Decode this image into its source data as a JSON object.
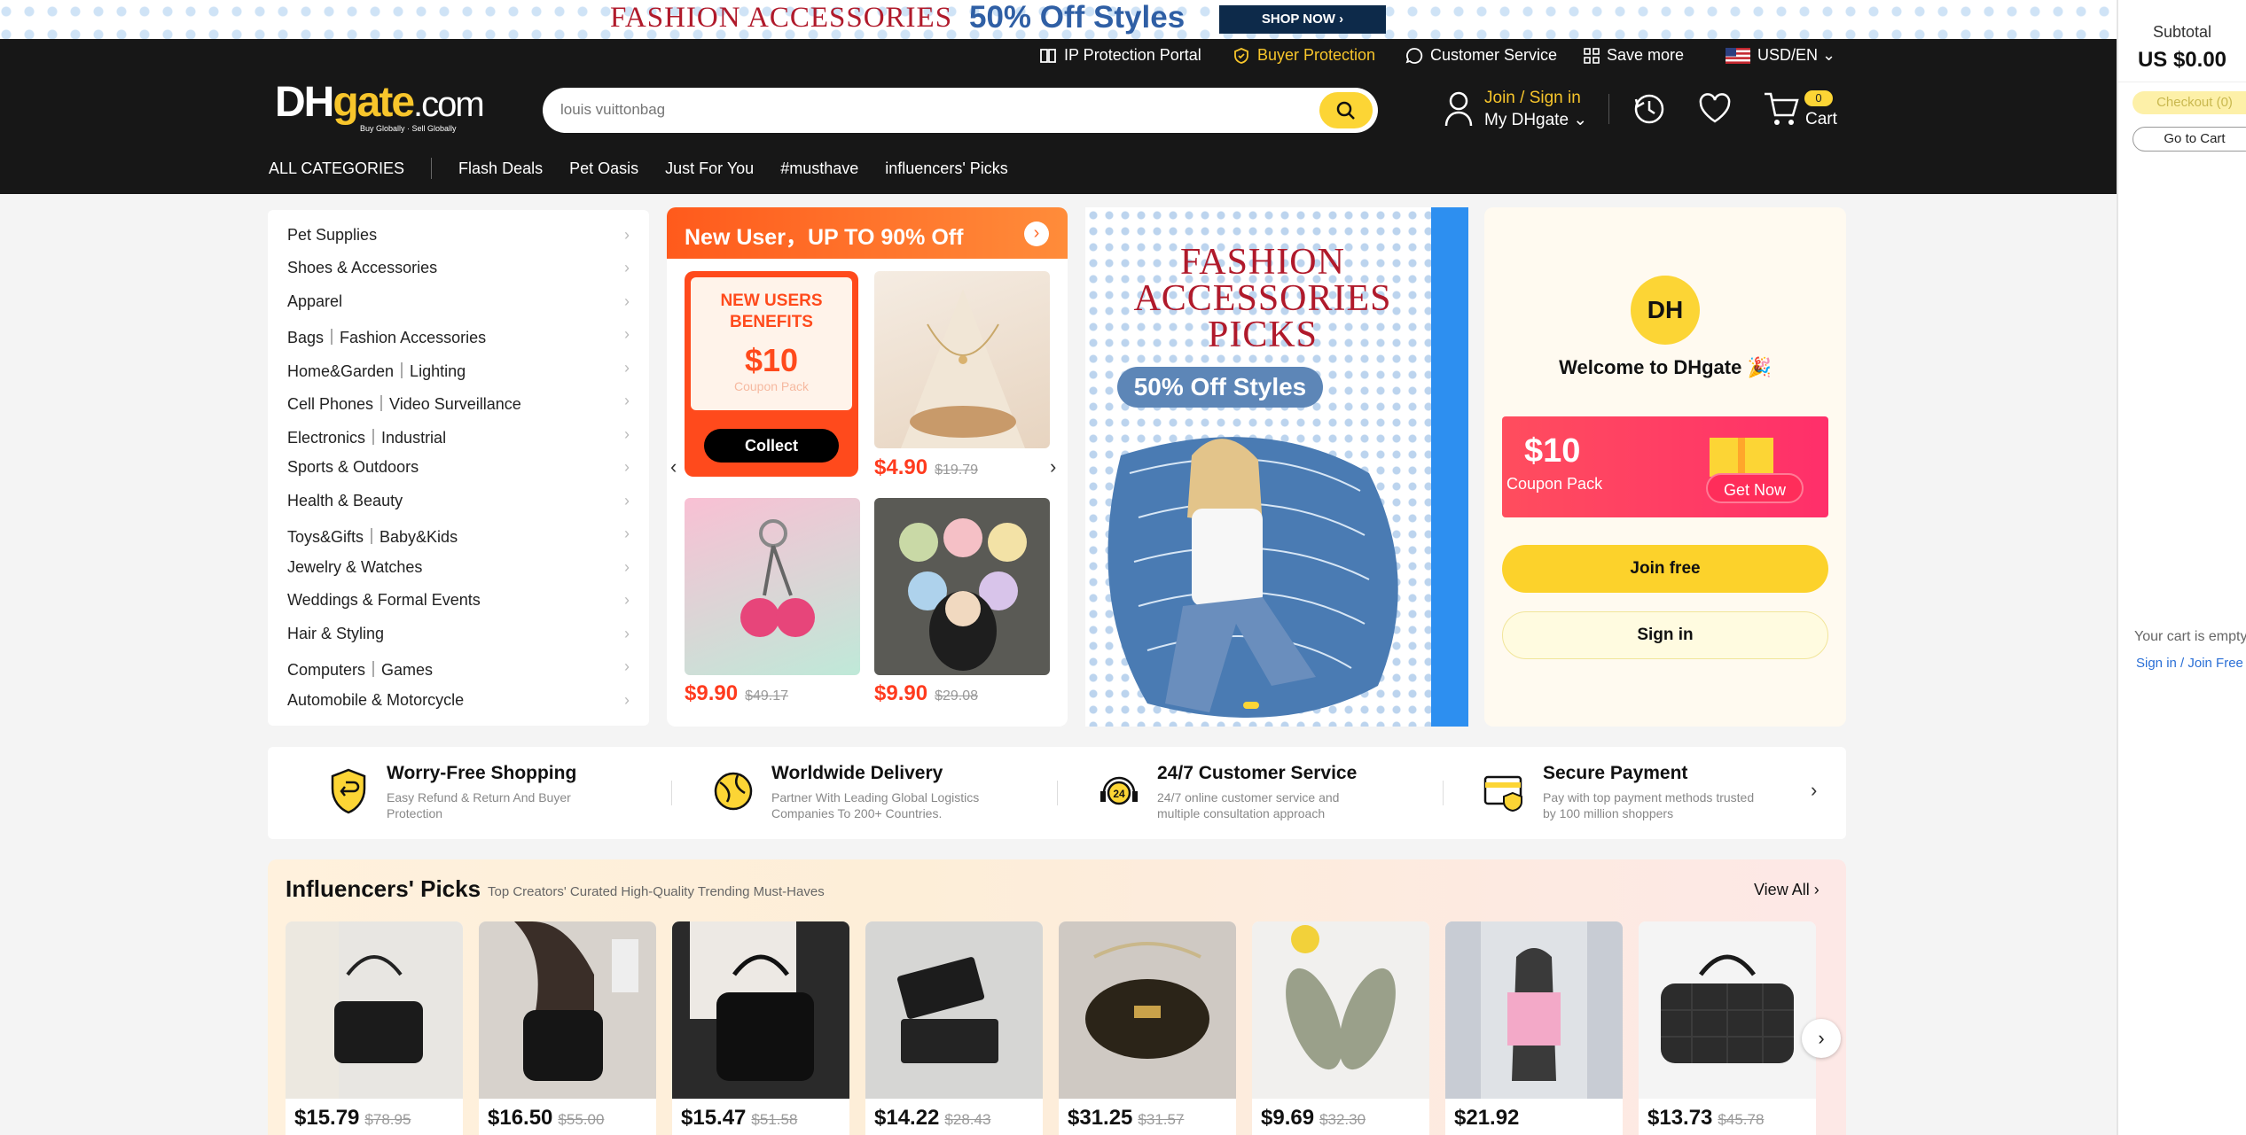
{
  "promo": {
    "text": "FASHION ACCESSORIES",
    "discount": "50% Off Styles",
    "button": "SHOP NOW  ›"
  },
  "header": {
    "toplinks": {
      "ip": "IP Protection Portal",
      "buyer": "Buyer Protection",
      "service": "Customer Service",
      "save": "Save more",
      "currency": "USD/EN ⌄"
    },
    "logo": {
      "main_dh": "DH",
      "main_gate": "gate",
      "main_com": ".com",
      "tagline": "Buy Globally · Sell Globally"
    },
    "search": {
      "placeholder": "louis vuittonbag"
    },
    "account": {
      "join": "Join / Sign in",
      "my": "My DHgate ⌄"
    },
    "cart": {
      "count": "0",
      "label": "Cart"
    },
    "nav": {
      "all": "ALL CATEGORIES",
      "items": [
        "Flash Deals",
        "Pet Oasis",
        "Just For You",
        "#musthave",
        "influencers' Picks"
      ]
    }
  },
  "cart_panel": {
    "subtotal_label": "Subtotal",
    "subtotal_value": "US $0.00",
    "checkout": "Checkout (0)",
    "goto": "Go to Cart",
    "empty": "Your cart is empty",
    "signin": "Sign in / Join Free"
  },
  "categories": [
    "Pet Supplies",
    "Shoes & Accessories",
    "Apparel",
    "Bags｜Fashion Accessories",
    "Home&Garden｜Lighting",
    "Cell Phones｜Video Surveillance",
    "Electronics｜Industrial",
    "Sports & Outdoors",
    "Health & Beauty",
    "Toys&Gifts｜Baby&Kids",
    "Jewelry & Watches",
    "Weddings & Formal Events",
    "Hair & Styling",
    "Computers｜Games",
    "Automobile & Motorcycle"
  ],
  "new_user": {
    "title": "New User，UP TO 90% Off",
    "coupon": {
      "line1": "NEW USERS",
      "line2": "BENEFITS",
      "amount": "$10",
      "label": "Coupon Pack",
      "button": "Collect"
    },
    "products": [
      {
        "price": "$4.90",
        "old": "$19.79"
      },
      {
        "price": "$9.90",
        "old": "$49.17"
      },
      {
        "price": "$9.90",
        "old": "$29.08"
      }
    ]
  },
  "banner": {
    "title": "FASHION ACCESSORIES PICKS",
    "pill": "50% Off Styles"
  },
  "welcome": {
    "avatar": "DH",
    "title": "Welcome to DHgate 🎉",
    "amount": "$10",
    "coupon_label": "Coupon Pack",
    "get": "Get Now",
    "join": "Join free",
    "sign": "Sign in"
  },
  "features": [
    {
      "title": "Worry-Free Shopping",
      "desc": "Easy Refund & Return And Buyer Protection"
    },
    {
      "title": "Worldwide Delivery",
      "desc": "Partner With Leading Global Logistics Companies To 200+ Countries."
    },
    {
      "title": "24/7 Customer Service",
      "desc": "24/7 online customer service and multiple consultation approach"
    },
    {
      "title": "Secure Payment",
      "desc": "Pay with top payment methods trusted by 100 million shoppers"
    }
  ],
  "influencers": {
    "title": "Influencers' Picks",
    "subtitle": "Top Creators' Curated High-Quality Trending Must-Haves",
    "view_all": "View All ›",
    "items": [
      {
        "price": "$15.79",
        "old": "$78.95"
      },
      {
        "price": "$16.50",
        "old": "$55.00"
      },
      {
        "price": "$15.47",
        "old": "$51.58"
      },
      {
        "price": "$14.22",
        "old": "$28.43"
      },
      {
        "price": "$31.25",
        "old": "$31.57"
      },
      {
        "price": "$9.69",
        "old": "$32.30"
      },
      {
        "price": "$21.92",
        "old": ""
      },
      {
        "price": "$13.73",
        "old": "$45.78"
      }
    ]
  },
  "colors": {
    "accent": "#fcd535",
    "header_bg": "#171717",
    "price_red": "#ff3b1e",
    "promo_red": "#b01a2b"
  }
}
